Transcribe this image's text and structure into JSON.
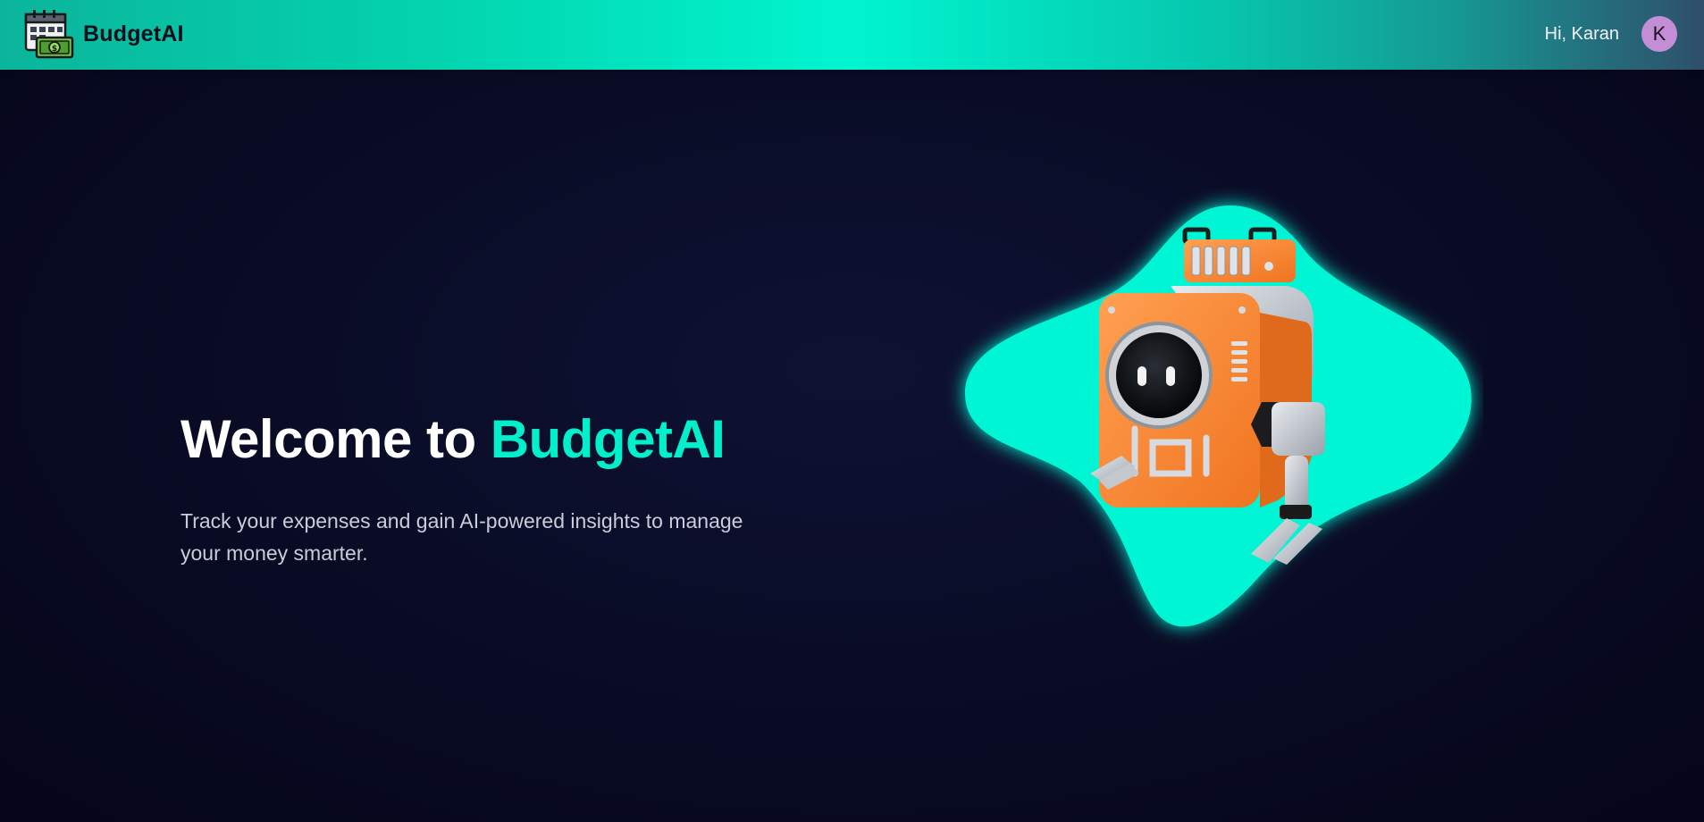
{
  "navbar": {
    "brand_name": "BudgetAI",
    "greeting": "Hi, Karan",
    "avatar_initial": "K"
  },
  "hero": {
    "title_prefix": "Welcome to ",
    "title_accent": "BudgetAI",
    "subtitle": "Track your expenses and gain AI-powered insights to manage your money smarter."
  },
  "illustration": {
    "icon": "robot-icon",
    "blob_color": "#00f5d4",
    "robot_color": "#ff8a3a"
  },
  "colors": {
    "accent": "#00f0cc",
    "background": "#090b24",
    "avatar": "#c48ed6"
  }
}
